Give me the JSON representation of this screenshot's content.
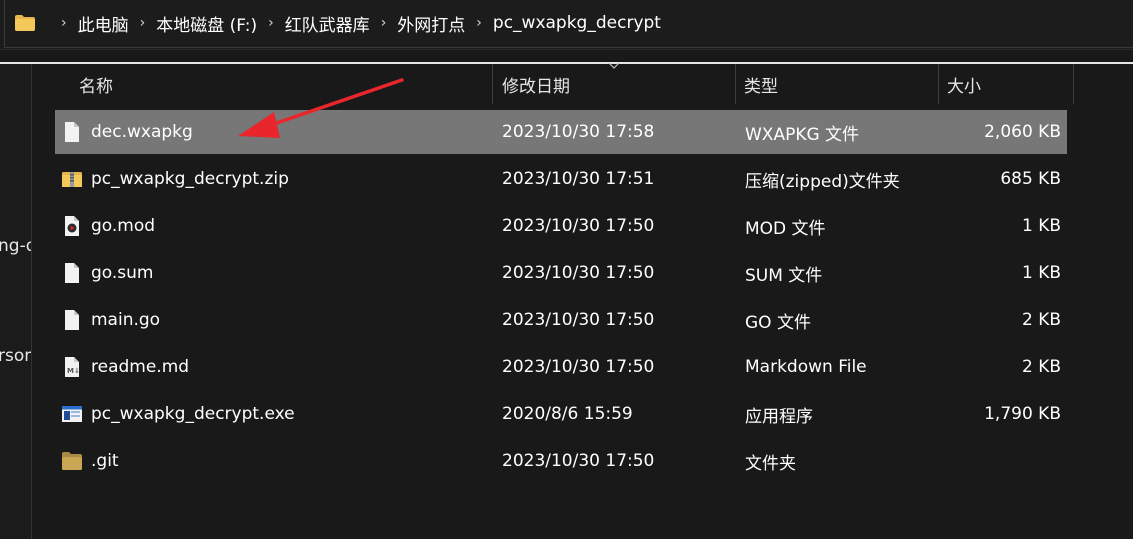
{
  "breadcrumb": [
    "此电脑",
    "本地磁盘 (F:)",
    "红队武器库",
    "外网打点",
    "pc_wxapkg_decrypt"
  ],
  "nav_fragments": [
    "ng-d",
    "rsona"
  ],
  "columns": {
    "name": "名称",
    "date": "修改日期",
    "type": "类型",
    "size": "大小"
  },
  "files": [
    {
      "name": "dec.wxapkg",
      "date": "2023/10/30 17:58",
      "type": "WXAPKG 文件",
      "size": "2,060 KB",
      "icon": "file-icon",
      "selected": true
    },
    {
      "name": "pc_wxapkg_decrypt.zip",
      "date": "2023/10/30 17:51",
      "type": "压缩(zipped)文件夹",
      "size": "685 KB",
      "icon": "zip-icon",
      "selected": false
    },
    {
      "name": "go.mod",
      "date": "2023/10/30 17:50",
      "type": "MOD 文件",
      "size": "1 KB",
      "icon": "media-file-icon",
      "selected": false
    },
    {
      "name": "go.sum",
      "date": "2023/10/30 17:50",
      "type": "SUM 文件",
      "size": "1 KB",
      "icon": "file-icon",
      "selected": false
    },
    {
      "name": "main.go",
      "date": "2023/10/30 17:50",
      "type": "GO 文件",
      "size": "2 KB",
      "icon": "file-icon",
      "selected": false
    },
    {
      "name": "readme.md",
      "date": "2023/10/30 17:50",
      "type": "Markdown File",
      "size": "2 KB",
      "icon": "markdown-file-icon",
      "selected": false
    },
    {
      "name": "pc_wxapkg_decrypt.exe",
      "date": "2020/8/6 15:59",
      "type": "应用程序",
      "size": "1,790 KB",
      "icon": "exe-icon",
      "selected": false
    },
    {
      "name": ".git",
      "date": "2023/10/30 17:50",
      "type": "文件夹",
      "size": "",
      "icon": "folder-icon",
      "selected": false
    }
  ],
  "colors": {
    "background": "#191919",
    "selected_row": "#777777",
    "arrow": "#e8262b",
    "folder": "#e8b54a"
  }
}
